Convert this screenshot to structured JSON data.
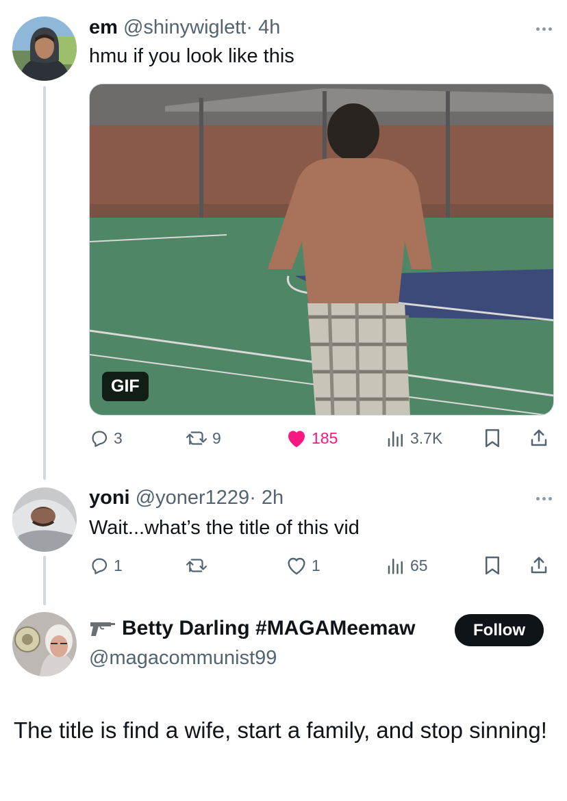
{
  "tweet1": {
    "name": "em",
    "handle": "@shinywiglett",
    "dot": "·",
    "time": "4h",
    "text": "hmu if you look like this",
    "gif_label": "GIF",
    "replies": "3",
    "retweets": "9",
    "likes": "185",
    "views": "3.7K"
  },
  "tweet2": {
    "name": "yoni",
    "handle": "@yoner1229",
    "dot": "·",
    "time": "2h",
    "text": "Wait...what’s the title of this vid",
    "replies": "1",
    "likes": "1",
    "views": "65"
  },
  "tweet3": {
    "name": "Betty Darling #MAGAMeemaw",
    "handle": "@magacommunist99",
    "follow_label": "Follow",
    "text": "The title is find a wife, start a family, and stop sinning!"
  },
  "colors": {
    "text": "#0f1419",
    "muted": "#536471",
    "like": "#f91880",
    "thread_line": "#cfd9de"
  },
  "icons": [
    "reply-icon",
    "retweet-icon",
    "heart-icon",
    "views-icon",
    "bookmark-icon",
    "share-icon",
    "gun-icon",
    "more-icon"
  ]
}
